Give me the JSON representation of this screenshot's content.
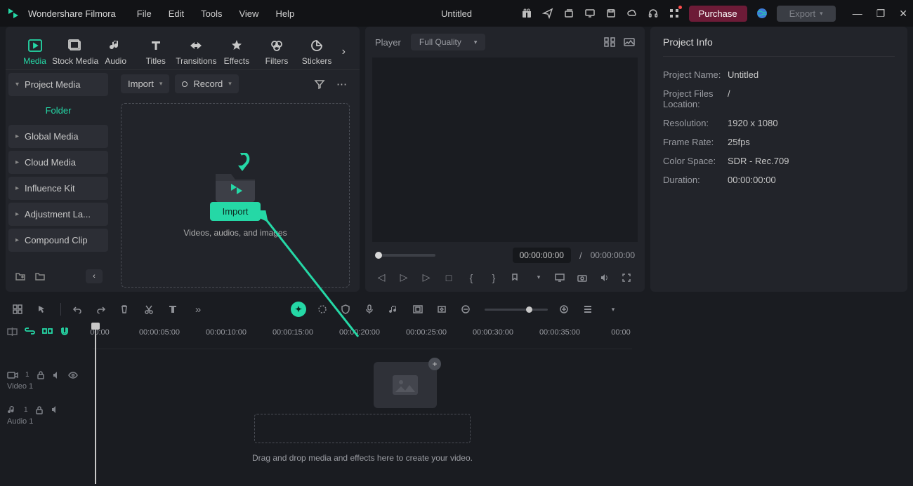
{
  "app": {
    "name": "Wondershare Filmora",
    "document": "Untitled"
  },
  "menu": [
    "File",
    "Edit",
    "Tools",
    "View",
    "Help"
  ],
  "titlebar_buttons": {
    "purchase": "Purchase",
    "export": "Export"
  },
  "tabs": [
    {
      "id": "media",
      "label": "Media",
      "active": true
    },
    {
      "id": "stock",
      "label": "Stock Media"
    },
    {
      "id": "audio",
      "label": "Audio"
    },
    {
      "id": "titles",
      "label": "Titles"
    },
    {
      "id": "transitions",
      "label": "Transitions"
    },
    {
      "id": "effects",
      "label": "Effects"
    },
    {
      "id": "filters",
      "label": "Filters"
    },
    {
      "id": "stickers",
      "label": "Stickers"
    }
  ],
  "tree": {
    "project_media": "Project Media",
    "folder": "Folder",
    "items": [
      "Global Media",
      "Cloud Media",
      "Influence Kit",
      "Adjustment La...",
      "Compound Clip"
    ]
  },
  "media_toolbar": {
    "import": "Import",
    "record": "Record"
  },
  "import_zone": {
    "button": "Import",
    "hint": "Videos, audios, and images"
  },
  "player": {
    "label": "Player",
    "quality": "Full Quality",
    "time_current": "00:00:00:00",
    "time_total": "00:00:00:00"
  },
  "info": {
    "title": "Project Info",
    "rows": {
      "project_name_k": "Project Name:",
      "project_name_v": "Untitled",
      "location_k": "Project Files Location:",
      "location_v": "/",
      "resolution_k": "Resolution:",
      "resolution_v": "1920 x 1080",
      "framerate_k": "Frame Rate:",
      "framerate_v": "25fps",
      "colorspace_k": "Color Space:",
      "colorspace_v": "SDR - Rec.709",
      "duration_k": "Duration:",
      "duration_v": "00:00:00:00"
    }
  },
  "ruler": [
    "00:00",
    "00:00:05:00",
    "00:00:10:00",
    "00:00:15:00",
    "00:00:20:00",
    "00:00:25:00",
    "00:00:30:00",
    "00:00:35:00",
    "00:00"
  ],
  "tracks": {
    "video1": "Video 1",
    "audio1": "Audio 1"
  },
  "timeline_hint": "Drag and drop media and effects here to create your video."
}
